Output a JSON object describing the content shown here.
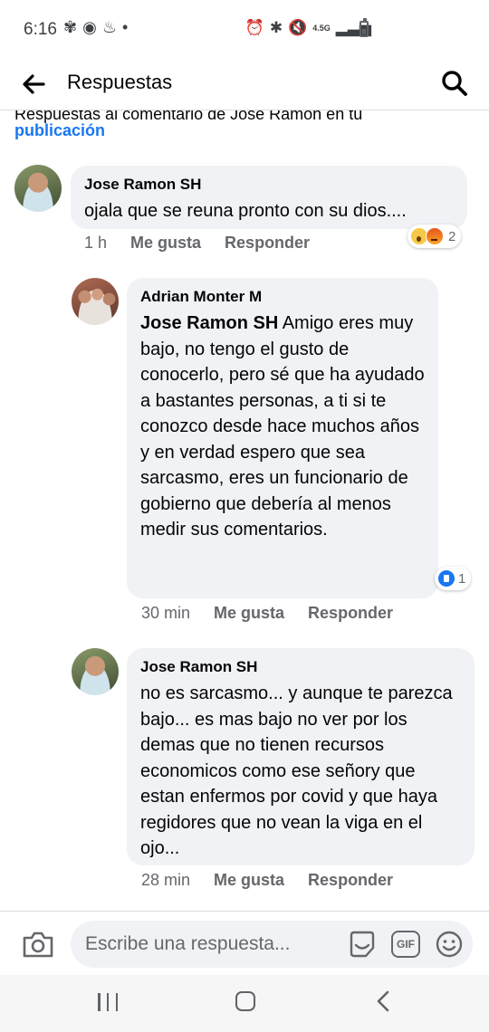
{
  "status_bar": {
    "time": "6:16",
    "left_icons": [
      "pinwheel-icon",
      "spotify-icon",
      "assistant-icon",
      "dot-icon"
    ],
    "right_icons": [
      "alarm-icon",
      "bluetooth-icon",
      "mute-icon",
      "lte-icon",
      "signal-icon",
      "battery-icon"
    ],
    "network": "4.5G"
  },
  "header": {
    "title": "Respuestas"
  },
  "context": {
    "text": "Respuestas al comentario de Jose Ramon en tu",
    "link": "publicación"
  },
  "comments": [
    {
      "author": "Jose Ramon SH",
      "text": "ojala que se reuna pronto con su dios....",
      "time": "1 h",
      "like_label": "Me gusta",
      "reply_label": "Responder",
      "reactions": [
        "wow",
        "angry"
      ],
      "reaction_count": "2"
    },
    {
      "author": "Adrian Monter M",
      "mention": "Jose Ramon SH",
      "text": " Amigo eres muy bajo, no tengo el gusto de conocerlo, pero sé que ha ayudado a bastantes personas, a ti si te conozco desde hace muchos años y en verdad espero que sea sarcasmo, eres un funcionario de gobierno que debería al menos medir sus comentarios.",
      "time": "30 min",
      "like_label": "Me gusta",
      "reply_label": "Responder",
      "reactions": [
        "like"
      ],
      "reaction_count": "1"
    },
    {
      "author": "Jose Ramon SH",
      "text": "no es sarcasmo... y aunque te parezca bajo... es mas bajo no ver por los demas que no tienen recursos economicos como ese señory  que estan enfermos por covid y que haya regidores que no vean la viga en el ojo...",
      "time": "28 min",
      "like_label": "Me gusta",
      "reply_label": "Responder"
    }
  ],
  "footer": {
    "placeholder": "Escribe una respuesta...",
    "gif_label": "GIF"
  },
  "colors": {
    "link": "#1877f2",
    "bubble": "#f0f2f5",
    "meta_text": "#65676b"
  }
}
